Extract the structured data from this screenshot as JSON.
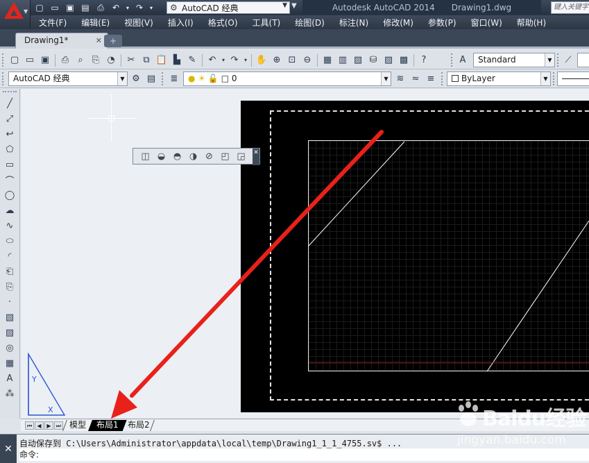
{
  "app": {
    "title": "Autodesk AutoCAD 2014",
    "filename": "Drawing1.dwg",
    "workspace": "AutoCAD 经典",
    "search_placeholder": "键入关键字"
  },
  "qat": {
    "icons": [
      "new-icon",
      "open-icon",
      "save-icon",
      "save-as-icon",
      "plot-icon",
      "undo-icon",
      "redo-icon"
    ]
  },
  "menu": {
    "items": [
      "文件(F)",
      "编辑(E)",
      "视图(V)",
      "插入(I)",
      "格式(O)",
      "工具(T)",
      "绘图(D)",
      "标注(N)",
      "修改(M)",
      "参数(P)",
      "窗口(W)",
      "帮助(H)"
    ]
  },
  "doc_tab": {
    "label": "Drawing1*"
  },
  "toolbars": {
    "workspace_combo": "AutoCAD 经典",
    "layer_combo": "0",
    "text_style_combo": "Standard",
    "color_combo": "ByLayer"
  },
  "layout_tabs": {
    "items": [
      "模型",
      "布局1",
      "布局2"
    ],
    "active": "布局1"
  },
  "command_line": {
    "history": "自动保存到 C:\\Users\\Administrator\\appdata\\local\\temp\\Drawing1_1_1_4755.sv$ ...",
    "prompt": "命令:"
  },
  "watermark": {
    "brand": "Baidu经验",
    "url": "jingyan.baidu.com"
  },
  "colors": {
    "arrow": "#e8211a",
    "paper": "#000000",
    "titlebar": "#2d3644"
  }
}
